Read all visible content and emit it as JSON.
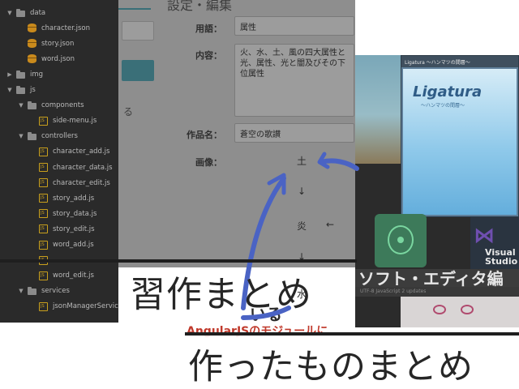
{
  "file_tree": {
    "items": [
      {
        "label": "data",
        "kind": "folder",
        "depth": 0,
        "chevron": "down"
      },
      {
        "label": "character.json",
        "kind": "db",
        "depth": 1
      },
      {
        "label": "story.json",
        "kind": "db",
        "depth": 1
      },
      {
        "label": "word.json",
        "kind": "db",
        "depth": 1
      },
      {
        "label": "img",
        "kind": "folder",
        "depth": 0,
        "chevron": "right"
      },
      {
        "label": "js",
        "kind": "folder",
        "depth": 0,
        "chevron": "down"
      },
      {
        "label": "components",
        "kind": "folder",
        "depth": 1,
        "chevron": "down"
      },
      {
        "label": "side-menu.js",
        "kind": "js",
        "depth": 2
      },
      {
        "label": "controllers",
        "kind": "folder",
        "depth": 1,
        "chevron": "down"
      },
      {
        "label": "character_add.js",
        "kind": "js",
        "depth": 2
      },
      {
        "label": "character_data.js",
        "kind": "js",
        "depth": 2
      },
      {
        "label": "character_edit.js",
        "kind": "js",
        "depth": 2
      },
      {
        "label": "story_add.js",
        "kind": "js",
        "depth": 2
      },
      {
        "label": "story_data.js",
        "kind": "js",
        "depth": 2
      },
      {
        "label": "story_edit.js",
        "kind": "js",
        "depth": 2
      },
      {
        "label": "word_add.js",
        "kind": "js",
        "depth": 2
      },
      {
        "label": "",
        "kind": "js",
        "depth": 2
      },
      {
        "label": "word_edit.js",
        "kind": "js",
        "depth": 2
      },
      {
        "label": "services",
        "kind": "folder",
        "depth": 1,
        "chevron": "down"
      },
      {
        "label": "jsonManagerService.js",
        "kind": "js",
        "depth": 2
      }
    ]
  },
  "form": {
    "heading": "設定・編集",
    "left_text": "る",
    "term_label": "用語：",
    "term_value": "属性",
    "content_label": "内容：",
    "content_value": "火、水、土、風の四大属性と光、属性、光と闇及びその下位属性",
    "work_label": "作品名：",
    "work_value": "蒼空の歌讃",
    "image_label": "画像："
  },
  "element_diagram": {
    "earth": "土",
    "arrow_down_1": "↓",
    "fire": "炎",
    "arrow_left": "←",
    "arrow_down_2": "↓",
    "water": "水"
  },
  "collage": {
    "ligatura_window_title": "Ligatura ～ハンマツの間層～",
    "ligatura_title": "Ligatura",
    "ligatura_sub": "～ハンマツの間層～",
    "vs_text": "Visual Studio",
    "editor_caption": "ソフト・エディタ編",
    "statusbar": "UTF-8   JavaScript   2 updates",
    "ha_fragment": "いる",
    "angular_text": "AngularJSのモジュールに"
  },
  "captions": {
    "primary": "習作まとめ",
    "secondary": "作ったものまとめ"
  },
  "colors": {
    "arrow_blue": "#4a63c4",
    "caption_ink": "#262626",
    "tree_bg": "#2a2a2a",
    "angular_red": "#c0392b"
  }
}
